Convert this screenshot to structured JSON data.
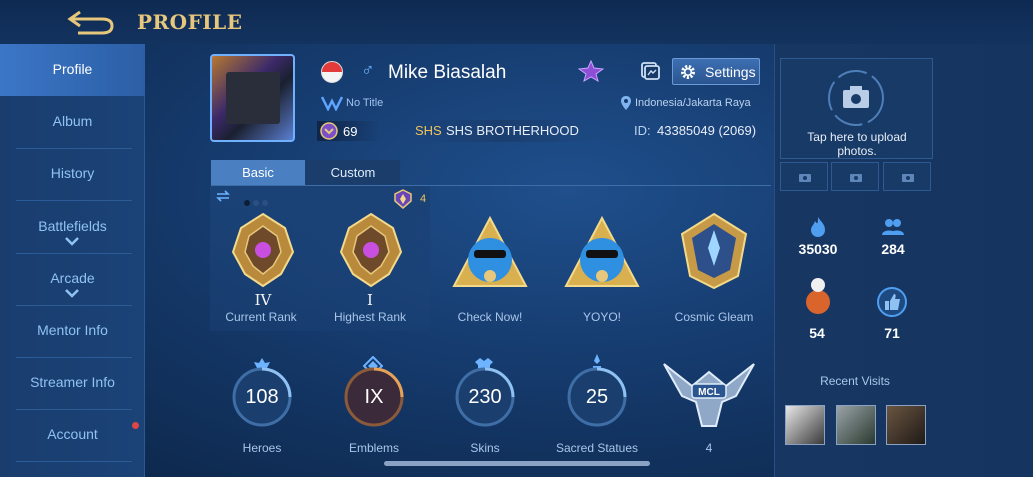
{
  "header": {
    "title": "PROFILE",
    "back_icon": "back-arrow-icon"
  },
  "sidebar": {
    "items": [
      {
        "label": "Profile",
        "active": true
      },
      {
        "label": "Album"
      },
      {
        "label": "History"
      },
      {
        "label": "Battlefields",
        "expandable": true
      },
      {
        "label": "Arcade",
        "expandable": true
      },
      {
        "label": "Mentor Info"
      },
      {
        "label": "Streamer Info"
      },
      {
        "label": "Account",
        "notification": true
      }
    ]
  },
  "profile": {
    "username": "Mike Biasalah",
    "gender_symbol": "♂",
    "title": "No Title",
    "location": "Indonesia/Jakarta Raya",
    "level": "69",
    "squad_tag": "SHS",
    "squad_name": "SHS BROTHERHOOD",
    "id_label": "ID:",
    "id_value": "43385049 (2069)",
    "settings_label": "Settings"
  },
  "tabs": [
    {
      "label": "Basic",
      "active": true
    },
    {
      "label": "Custom"
    }
  ],
  "ranks": {
    "mythic_count": "4",
    "items": [
      {
        "roman": "IV",
        "label": "Current Rank"
      },
      {
        "roman": "I",
        "label": "Highest Rank"
      }
    ]
  },
  "showcase": [
    {
      "label": "Check Now!"
    },
    {
      "label": "YOYO!"
    },
    {
      "label": "Cosmic Gleam"
    }
  ],
  "stats": [
    {
      "value": "108",
      "label": "Heroes"
    },
    {
      "value": "IX",
      "label": "Emblems"
    },
    {
      "value": "230",
      "label": "Skins"
    },
    {
      "value": "25",
      "label": "Sacred Statues"
    },
    {
      "value": "4",
      "label": ""
    }
  ],
  "right": {
    "upload_text": "Tap here to upload photos.",
    "popularity": "35030",
    "followers": "284",
    "gifts": "54",
    "likes": "71",
    "recent_visits_title": "Recent Visits"
  },
  "colors": {
    "accent_gold": "#e6c77b",
    "active_tab": "#4a7fc2",
    "squad_gold": "#f0c35a"
  }
}
